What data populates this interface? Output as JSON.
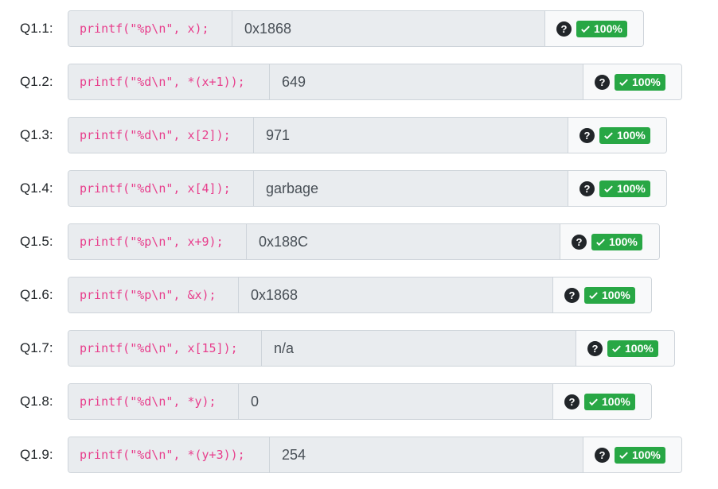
{
  "questions": [
    {
      "label": "Q1.1:",
      "code": "printf(\"%p\\n\", x);",
      "answer": "0x1868",
      "help": "?",
      "score": "100%"
    },
    {
      "label": "Q1.2:",
      "code": "printf(\"%d\\n\", *(x+1));",
      "answer": "649",
      "help": "?",
      "score": "100%"
    },
    {
      "label": "Q1.3:",
      "code": "printf(\"%d\\n\", x[2]);",
      "answer": "971",
      "help": "?",
      "score": "100%"
    },
    {
      "label": "Q1.4:",
      "code": "printf(\"%d\\n\", x[4]);",
      "answer": "garbage",
      "help": "?",
      "score": "100%"
    },
    {
      "label": "Q1.5:",
      "code": "printf(\"%p\\n\", x+9);",
      "answer": "0x188C",
      "help": "?",
      "score": "100%"
    },
    {
      "label": "Q1.6:",
      "code": "printf(\"%p\\n\", &x);",
      "answer": "0x1868",
      "help": "?",
      "score": "100%"
    },
    {
      "label": "Q1.7:",
      "code": "printf(\"%d\\n\", x[15]);",
      "answer": "n/a",
      "help": "?",
      "score": "100%"
    },
    {
      "label": "Q1.8:",
      "code": "printf(\"%d\\n\", *y);",
      "answer": "0",
      "help": "?",
      "score": "100%"
    },
    {
      "label": "Q1.9:",
      "code": "printf(\"%d\\n\", *(y+3));",
      "answer": "254",
      "help": "?",
      "score": "100%"
    }
  ],
  "colors": {
    "code": "#e83e8c",
    "badge": "#28a745",
    "help_icon": "#212529"
  },
  "icons": {
    "help": "question-circle-icon",
    "correct": "check-icon"
  }
}
